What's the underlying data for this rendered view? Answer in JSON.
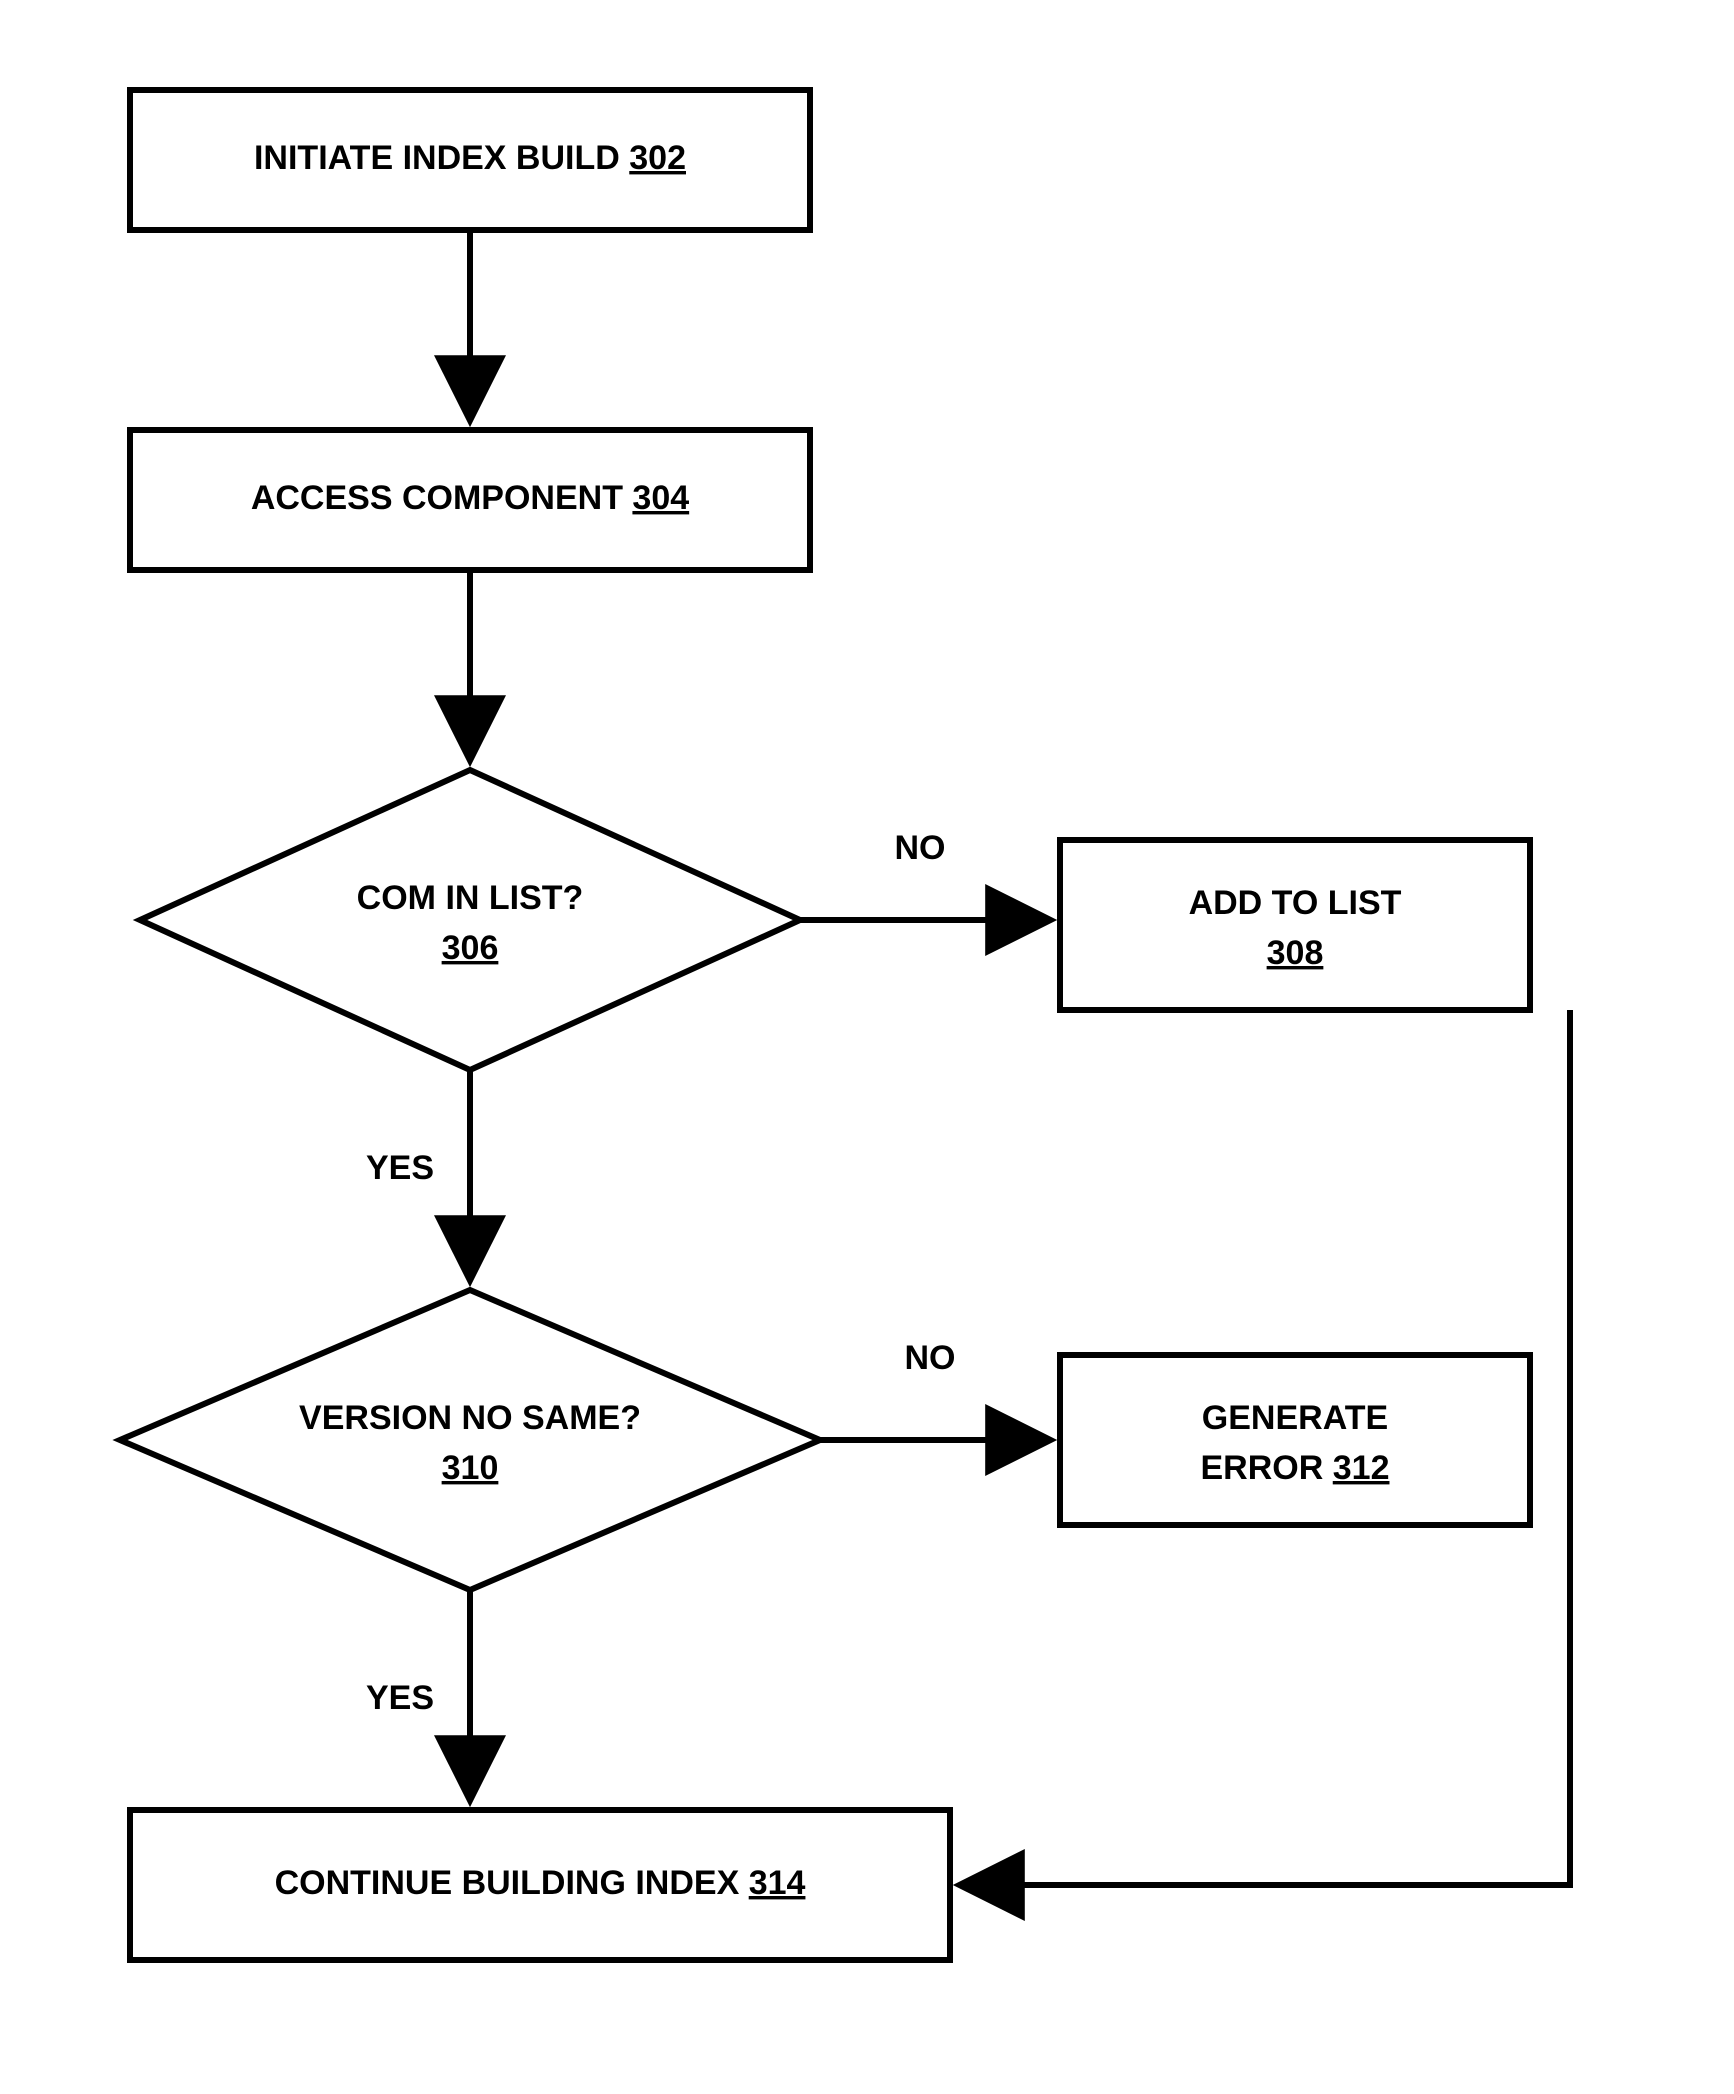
{
  "chart_data": {
    "type": "flowchart",
    "nodes": [
      {
        "id": "302",
        "kind": "process",
        "label": "INITIATE INDEX BUILD",
        "ref": "302"
      },
      {
        "id": "304",
        "kind": "process",
        "label": "ACCESS COMPONENT",
        "ref": "304"
      },
      {
        "id": "306",
        "kind": "decision",
        "label": "COM IN LIST?",
        "ref": "306"
      },
      {
        "id": "308",
        "kind": "process",
        "label": "ADD TO LIST",
        "ref": "308"
      },
      {
        "id": "310",
        "kind": "decision",
        "label": "VERSION NO SAME?",
        "ref": "310"
      },
      {
        "id": "312",
        "kind": "process",
        "label": "GENERATE ERROR",
        "ref": "312"
      },
      {
        "id": "314",
        "kind": "process",
        "label": "CONTINUE BUILDING INDEX",
        "ref": "314"
      }
    ],
    "edges": [
      {
        "from": "302",
        "to": "304",
        "label": ""
      },
      {
        "from": "304",
        "to": "306",
        "label": ""
      },
      {
        "from": "306",
        "to": "308",
        "label": "NO"
      },
      {
        "from": "306",
        "to": "310",
        "label": "YES"
      },
      {
        "from": "310",
        "to": "312",
        "label": "NO"
      },
      {
        "from": "310",
        "to": "314",
        "label": "YES"
      },
      {
        "from": "308",
        "to": "314",
        "label": ""
      }
    ]
  },
  "nodes": {
    "n302": {
      "label": "INITIATE INDEX BUILD",
      "ref": "302"
    },
    "n304": {
      "label": "ACCESS COMPONENT",
      "ref": "304"
    },
    "n306": {
      "label": "COM IN LIST?",
      "ref": "306"
    },
    "n308": {
      "label": "ADD TO LIST",
      "ref": "308"
    },
    "n310": {
      "label": "VERSION NO SAME?",
      "ref": "310"
    },
    "n312a": {
      "label": "GENERATE"
    },
    "n312b": {
      "label": "ERROR",
      "ref": "312"
    },
    "n314": {
      "label": "CONTINUE BUILDING INDEX",
      "ref": "314"
    }
  },
  "edgeLabels": {
    "e306_no": "NO",
    "e306_yes": "YES",
    "e310_no": "NO",
    "e310_yes": "YES"
  }
}
